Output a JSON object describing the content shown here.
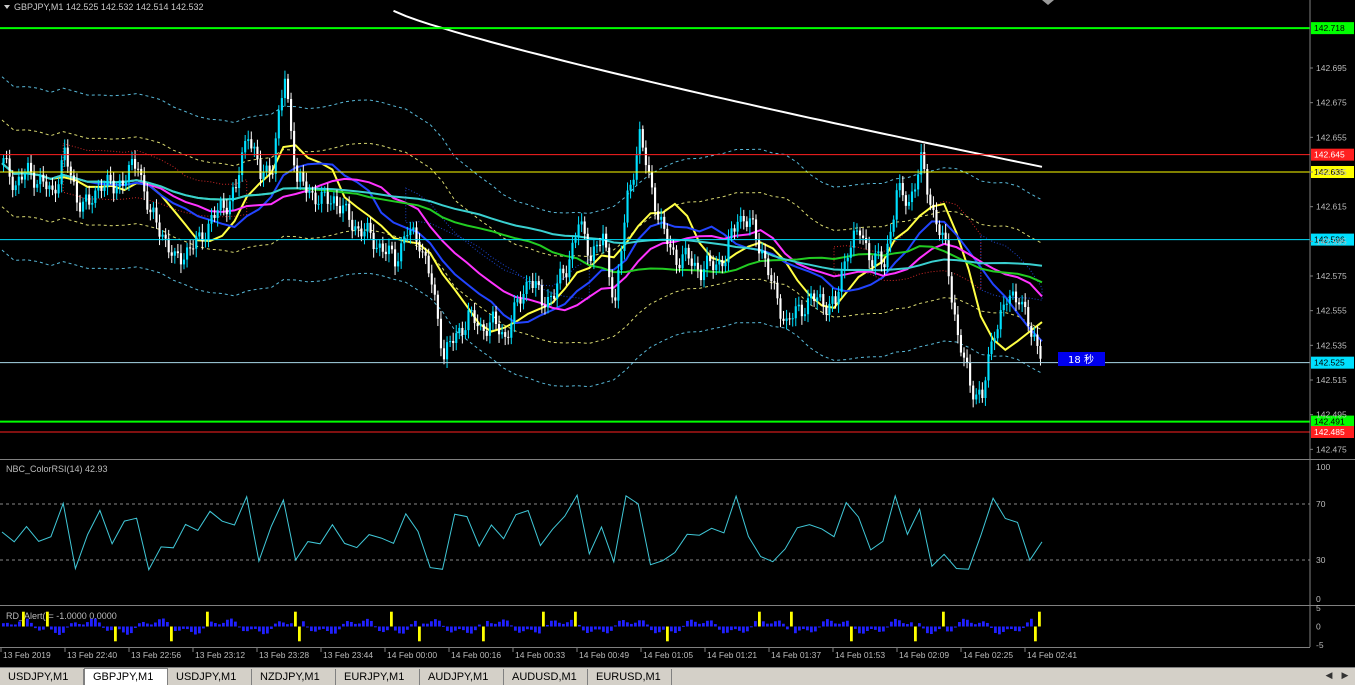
{
  "header": {
    "symbol_line": "GBPJPY,M1  142.525 142.532 142.514 142.532",
    "dropdown_icon": "triangle-down-icon"
  },
  "colors": {
    "background": "#000000",
    "bull": "#00e0ff",
    "bear": "#ffffff",
    "green_level": "#00ff00",
    "red_level": "#ff2020",
    "yellow_level": "#ffff00",
    "cyan_level": "#00e0ff",
    "ma_white": "#ffffff",
    "ma_cyan": "#3ad0d0",
    "ma_green": "#22cc22",
    "ma_magenta": "#ff33ff",
    "ma_blue": "#2244ff",
    "ma_yellow": "#ffff44",
    "rsi_line": "#40c8d8",
    "rd_bar_blue": "#2020ff",
    "rd_bar_yellow": "#ffff00"
  },
  "price_axis": {
    "labels": [
      "142.695",
      "142.675",
      "142.655",
      "142.635",
      "142.615",
      "142.595",
      "142.575",
      "142.555",
      "142.535",
      "142.515",
      "142.495",
      "142.475"
    ],
    "min": 142.47,
    "max": 142.725
  },
  "price_levels": [
    {
      "value": "142.718",
      "type": "green"
    },
    {
      "value": "142.645",
      "type": "red"
    },
    {
      "value": "142.635",
      "type": "yellow"
    },
    {
      "value": "142.596",
      "type": "cyan"
    },
    {
      "value": "142.525",
      "type": "current"
    },
    {
      "value": "142.491",
      "type": "green"
    },
    {
      "value": "142.485",
      "type": "red"
    }
  ],
  "countdown": "18 秒",
  "rsi_panel": {
    "title": "NBC_ColorRSI(14) 42.93",
    "labels": [
      "100",
      "70",
      "30",
      "0"
    ],
    "upper": 70,
    "lower": 30
  },
  "rd_panel": {
    "title": "RD_Alert()= -1.0000 0.0000",
    "labels": [
      "5",
      "0",
      "-5"
    ]
  },
  "time_axis": [
    "13 Feb 2019",
    "13 Feb 22:40",
    "13 Feb 22:56",
    "13 Feb 23:12",
    "13 Feb 23:28",
    "13 Feb 23:44",
    "14 Feb 00:00",
    "14 Feb 00:16",
    "14 Feb 00:33",
    "14 Feb 00:49",
    "14 Feb 01:05",
    "14 Feb 01:21",
    "14 Feb 01:37",
    "14 Feb 01:53",
    "14 Feb 02:09",
    "14 Feb 02:25",
    "14 Feb 02:41"
  ],
  "tabs": [
    {
      "label": "USDJPY,M1",
      "active": false
    },
    {
      "label": "GBPJPY,M1",
      "active": true
    },
    {
      "label": "USDJPY,M1",
      "active": false
    },
    {
      "label": "NZDJPY,M1",
      "active": false
    },
    {
      "label": "EURJPY,M1",
      "active": false
    },
    {
      "label": "AUDJPY,M1",
      "active": false
    },
    {
      "label": "AUDUSD,M1",
      "active": false
    },
    {
      "label": "EURUSD,M1",
      "active": false
    }
  ],
  "scroll_left_icon": "arrow-left-icon",
  "scroll_right_icon": "arrow-right-icon",
  "chart_data": {
    "type": "candlestick",
    "symbol": "GBPJPY",
    "timeframe": "M1",
    "ohlc_header": {
      "open": 142.525,
      "high": 142.532,
      "low": 142.514,
      "close": 142.532
    },
    "close_series": [
      142.64,
      142.628,
      142.635,
      142.63,
      142.622,
      142.645,
      142.62,
      142.615,
      142.63,
      142.625,
      142.633,
      142.64,
      142.61,
      142.6,
      142.583,
      142.59,
      142.595,
      142.608,
      142.615,
      142.625,
      142.66,
      142.632,
      142.64,
      142.69,
      142.63,
      142.624,
      142.618,
      142.62,
      142.61,
      142.602,
      142.598,
      142.59,
      142.585,
      142.6,
      142.596,
      142.57,
      142.53,
      142.54,
      142.552,
      142.545,
      142.548,
      142.54,
      142.558,
      142.575,
      142.56,
      142.565,
      142.58,
      142.605,
      142.588,
      142.596,
      142.56,
      142.62,
      142.655,
      142.625,
      142.598,
      142.585,
      142.585,
      142.578,
      142.582,
      142.585,
      142.61,
      142.605,
      142.59,
      142.565,
      142.548,
      142.555,
      142.562,
      142.56,
      142.558,
      142.592,
      142.6,
      142.585,
      142.582,
      142.623,
      142.618,
      142.64,
      142.612,
      142.59,
      142.54,
      142.512,
      142.505,
      142.545,
      142.56,
      142.565,
      142.54,
      142.532
    ],
    "price_levels": [
      142.718,
      142.645,
      142.635,
      142.596,
      142.525,
      142.491,
      142.485
    ],
    "rsi": {
      "period": 14,
      "last": 42.93,
      "levels": [
        30,
        70
      ],
      "ylim": [
        0,
        100
      ]
    },
    "rd_alert": {
      "values": [
        -1.0,
        0.0
      ],
      "ylim": [
        -5,
        5
      ]
    }
  }
}
